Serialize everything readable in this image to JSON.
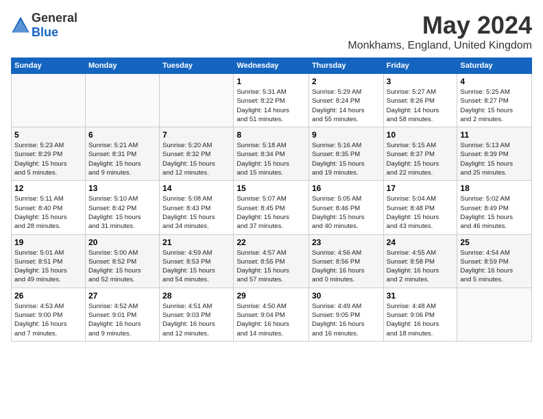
{
  "logo": {
    "text_general": "General",
    "text_blue": "Blue"
  },
  "title": {
    "month": "May 2024",
    "location": "Monkhams, England, United Kingdom"
  },
  "headers": [
    "Sunday",
    "Monday",
    "Tuesday",
    "Wednesday",
    "Thursday",
    "Friday",
    "Saturday"
  ],
  "weeks": [
    [
      {
        "day": "",
        "info": ""
      },
      {
        "day": "",
        "info": ""
      },
      {
        "day": "",
        "info": ""
      },
      {
        "day": "1",
        "info": "Sunrise: 5:31 AM\nSunset: 8:22 PM\nDaylight: 14 hours\nand 51 minutes."
      },
      {
        "day": "2",
        "info": "Sunrise: 5:29 AM\nSunset: 8:24 PM\nDaylight: 14 hours\nand 55 minutes."
      },
      {
        "day": "3",
        "info": "Sunrise: 5:27 AM\nSunset: 8:26 PM\nDaylight: 14 hours\nand 58 minutes."
      },
      {
        "day": "4",
        "info": "Sunrise: 5:25 AM\nSunset: 8:27 PM\nDaylight: 15 hours\nand 2 minutes."
      }
    ],
    [
      {
        "day": "5",
        "info": "Sunrise: 5:23 AM\nSunset: 8:29 PM\nDaylight: 15 hours\nand 5 minutes."
      },
      {
        "day": "6",
        "info": "Sunrise: 5:21 AM\nSunset: 8:31 PM\nDaylight: 15 hours\nand 9 minutes."
      },
      {
        "day": "7",
        "info": "Sunrise: 5:20 AM\nSunset: 8:32 PM\nDaylight: 15 hours\nand 12 minutes."
      },
      {
        "day": "8",
        "info": "Sunrise: 5:18 AM\nSunset: 8:34 PM\nDaylight: 15 hours\nand 15 minutes."
      },
      {
        "day": "9",
        "info": "Sunrise: 5:16 AM\nSunset: 8:35 PM\nDaylight: 15 hours\nand 19 minutes."
      },
      {
        "day": "10",
        "info": "Sunrise: 5:15 AM\nSunset: 8:37 PM\nDaylight: 15 hours\nand 22 minutes."
      },
      {
        "day": "11",
        "info": "Sunrise: 5:13 AM\nSunset: 8:39 PM\nDaylight: 15 hours\nand 25 minutes."
      }
    ],
    [
      {
        "day": "12",
        "info": "Sunrise: 5:11 AM\nSunset: 8:40 PM\nDaylight: 15 hours\nand 28 minutes."
      },
      {
        "day": "13",
        "info": "Sunrise: 5:10 AM\nSunset: 8:42 PM\nDaylight: 15 hours\nand 31 minutes."
      },
      {
        "day": "14",
        "info": "Sunrise: 5:08 AM\nSunset: 8:43 PM\nDaylight: 15 hours\nand 34 minutes."
      },
      {
        "day": "15",
        "info": "Sunrise: 5:07 AM\nSunset: 8:45 PM\nDaylight: 15 hours\nand 37 minutes."
      },
      {
        "day": "16",
        "info": "Sunrise: 5:05 AM\nSunset: 8:46 PM\nDaylight: 15 hours\nand 40 minutes."
      },
      {
        "day": "17",
        "info": "Sunrise: 5:04 AM\nSunset: 8:48 PM\nDaylight: 15 hours\nand 43 minutes."
      },
      {
        "day": "18",
        "info": "Sunrise: 5:02 AM\nSunset: 8:49 PM\nDaylight: 15 hours\nand 46 minutes."
      }
    ],
    [
      {
        "day": "19",
        "info": "Sunrise: 5:01 AM\nSunset: 8:51 PM\nDaylight: 15 hours\nand 49 minutes."
      },
      {
        "day": "20",
        "info": "Sunrise: 5:00 AM\nSunset: 8:52 PM\nDaylight: 15 hours\nand 52 minutes."
      },
      {
        "day": "21",
        "info": "Sunrise: 4:59 AM\nSunset: 8:53 PM\nDaylight: 15 hours\nand 54 minutes."
      },
      {
        "day": "22",
        "info": "Sunrise: 4:57 AM\nSunset: 8:55 PM\nDaylight: 15 hours\nand 57 minutes."
      },
      {
        "day": "23",
        "info": "Sunrise: 4:56 AM\nSunset: 8:56 PM\nDaylight: 16 hours\nand 0 minutes."
      },
      {
        "day": "24",
        "info": "Sunrise: 4:55 AM\nSunset: 8:58 PM\nDaylight: 16 hours\nand 2 minutes."
      },
      {
        "day": "25",
        "info": "Sunrise: 4:54 AM\nSunset: 8:59 PM\nDaylight: 16 hours\nand 5 minutes."
      }
    ],
    [
      {
        "day": "26",
        "info": "Sunrise: 4:53 AM\nSunset: 9:00 PM\nDaylight: 16 hours\nand 7 minutes."
      },
      {
        "day": "27",
        "info": "Sunrise: 4:52 AM\nSunset: 9:01 PM\nDaylight: 16 hours\nand 9 minutes."
      },
      {
        "day": "28",
        "info": "Sunrise: 4:51 AM\nSunset: 9:03 PM\nDaylight: 16 hours\nand 12 minutes."
      },
      {
        "day": "29",
        "info": "Sunrise: 4:50 AM\nSunset: 9:04 PM\nDaylight: 16 hours\nand 14 minutes."
      },
      {
        "day": "30",
        "info": "Sunrise: 4:49 AM\nSunset: 9:05 PM\nDaylight: 16 hours\nand 16 minutes."
      },
      {
        "day": "31",
        "info": "Sunrise: 4:48 AM\nSunset: 9:06 PM\nDaylight: 16 hours\nand 18 minutes."
      },
      {
        "day": "",
        "info": ""
      }
    ]
  ]
}
